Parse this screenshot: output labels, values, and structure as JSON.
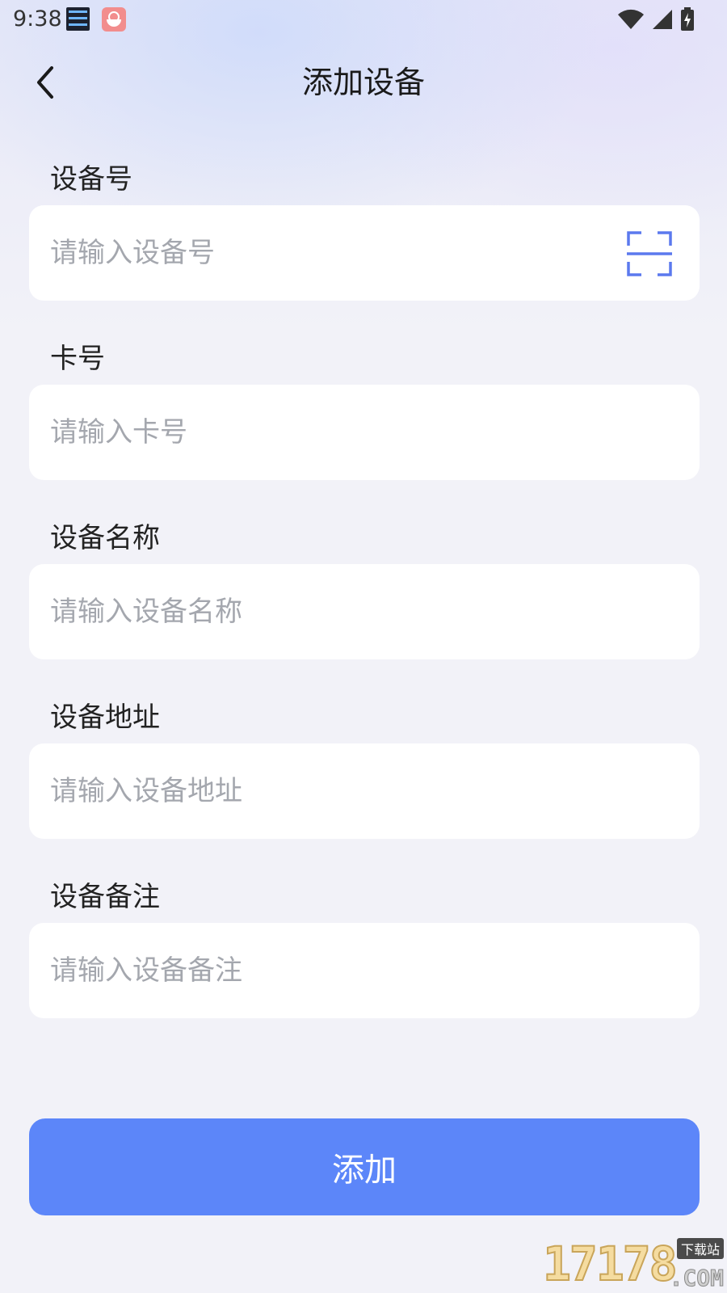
{
  "status_bar": {
    "time": "9:38",
    "icons": [
      "clock-widget-icon",
      "rice-bowl-app-icon",
      "wifi-icon",
      "signal-icon",
      "battery-charging-icon"
    ]
  },
  "header": {
    "title": "添加设备",
    "back_icon": "chevron-left-icon"
  },
  "form": {
    "fields": [
      {
        "label": "设备号",
        "placeholder": "请输入设备号",
        "value": "",
        "trailing_icon": "scan-icon"
      },
      {
        "label": "卡号",
        "placeholder": "请输入卡号",
        "value": ""
      },
      {
        "label": "设备名称",
        "placeholder": "请输入设备名称",
        "value": ""
      },
      {
        "label": "设备地址",
        "placeholder": "请输入设备地址",
        "value": ""
      },
      {
        "label": "设备备注",
        "placeholder": "请输入设备备注",
        "value": ""
      }
    ]
  },
  "submit": {
    "label": "添加"
  },
  "watermark": {
    "number": "17178",
    "suffix": ".COM",
    "tag": "下载站"
  },
  "colors": {
    "accent": "#5c86f9",
    "scan_icon": "#5b79ee",
    "placeholder": "#a4a7ae",
    "page_bg": "#f2f2f8"
  }
}
